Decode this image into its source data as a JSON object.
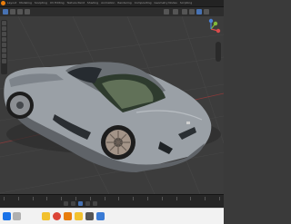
{
  "app": {
    "name": "Blender"
  },
  "menu": [
    {
      "label": "Layout"
    },
    {
      "label": "Modeling"
    },
    {
      "label": "Sculpting"
    },
    {
      "label": "UV Editing"
    },
    {
      "label": "Texture Paint"
    },
    {
      "label": "Shading"
    },
    {
      "label": "Animation"
    },
    {
      "label": "Rendering"
    },
    {
      "label": "Compositing"
    },
    {
      "label": "Geometry Nodes"
    },
    {
      "label": "Scripting"
    }
  ],
  "viewport": {
    "background": "#3c3c3c",
    "grid_color": "#474747",
    "axis_x_color": "#8a3a3a",
    "axis_y_color": "#6f8a3a",
    "car_body_color": "#9aa0a6"
  },
  "gizmo": {
    "x_color": "#d94b4b",
    "y_color": "#83b93a",
    "z_color": "#4b83d9"
  },
  "taskbar": {
    "icons": [
      {
        "name": "start-icon",
        "color": "#1a73e8"
      },
      {
        "name": "search-icon",
        "color": "#666666"
      },
      {
        "name": "file-explorer-icon",
        "color": "#f2c12e"
      },
      {
        "name": "chrome-icon",
        "color": "#db4437"
      },
      {
        "name": "blender-icon",
        "color": "#e87d0d"
      },
      {
        "name": "folder-icon",
        "color": "#f2c12e"
      },
      {
        "name": "settings-icon",
        "color": "#555555"
      },
      {
        "name": "app-icon",
        "color": "#3a7bd5"
      }
    ]
  }
}
